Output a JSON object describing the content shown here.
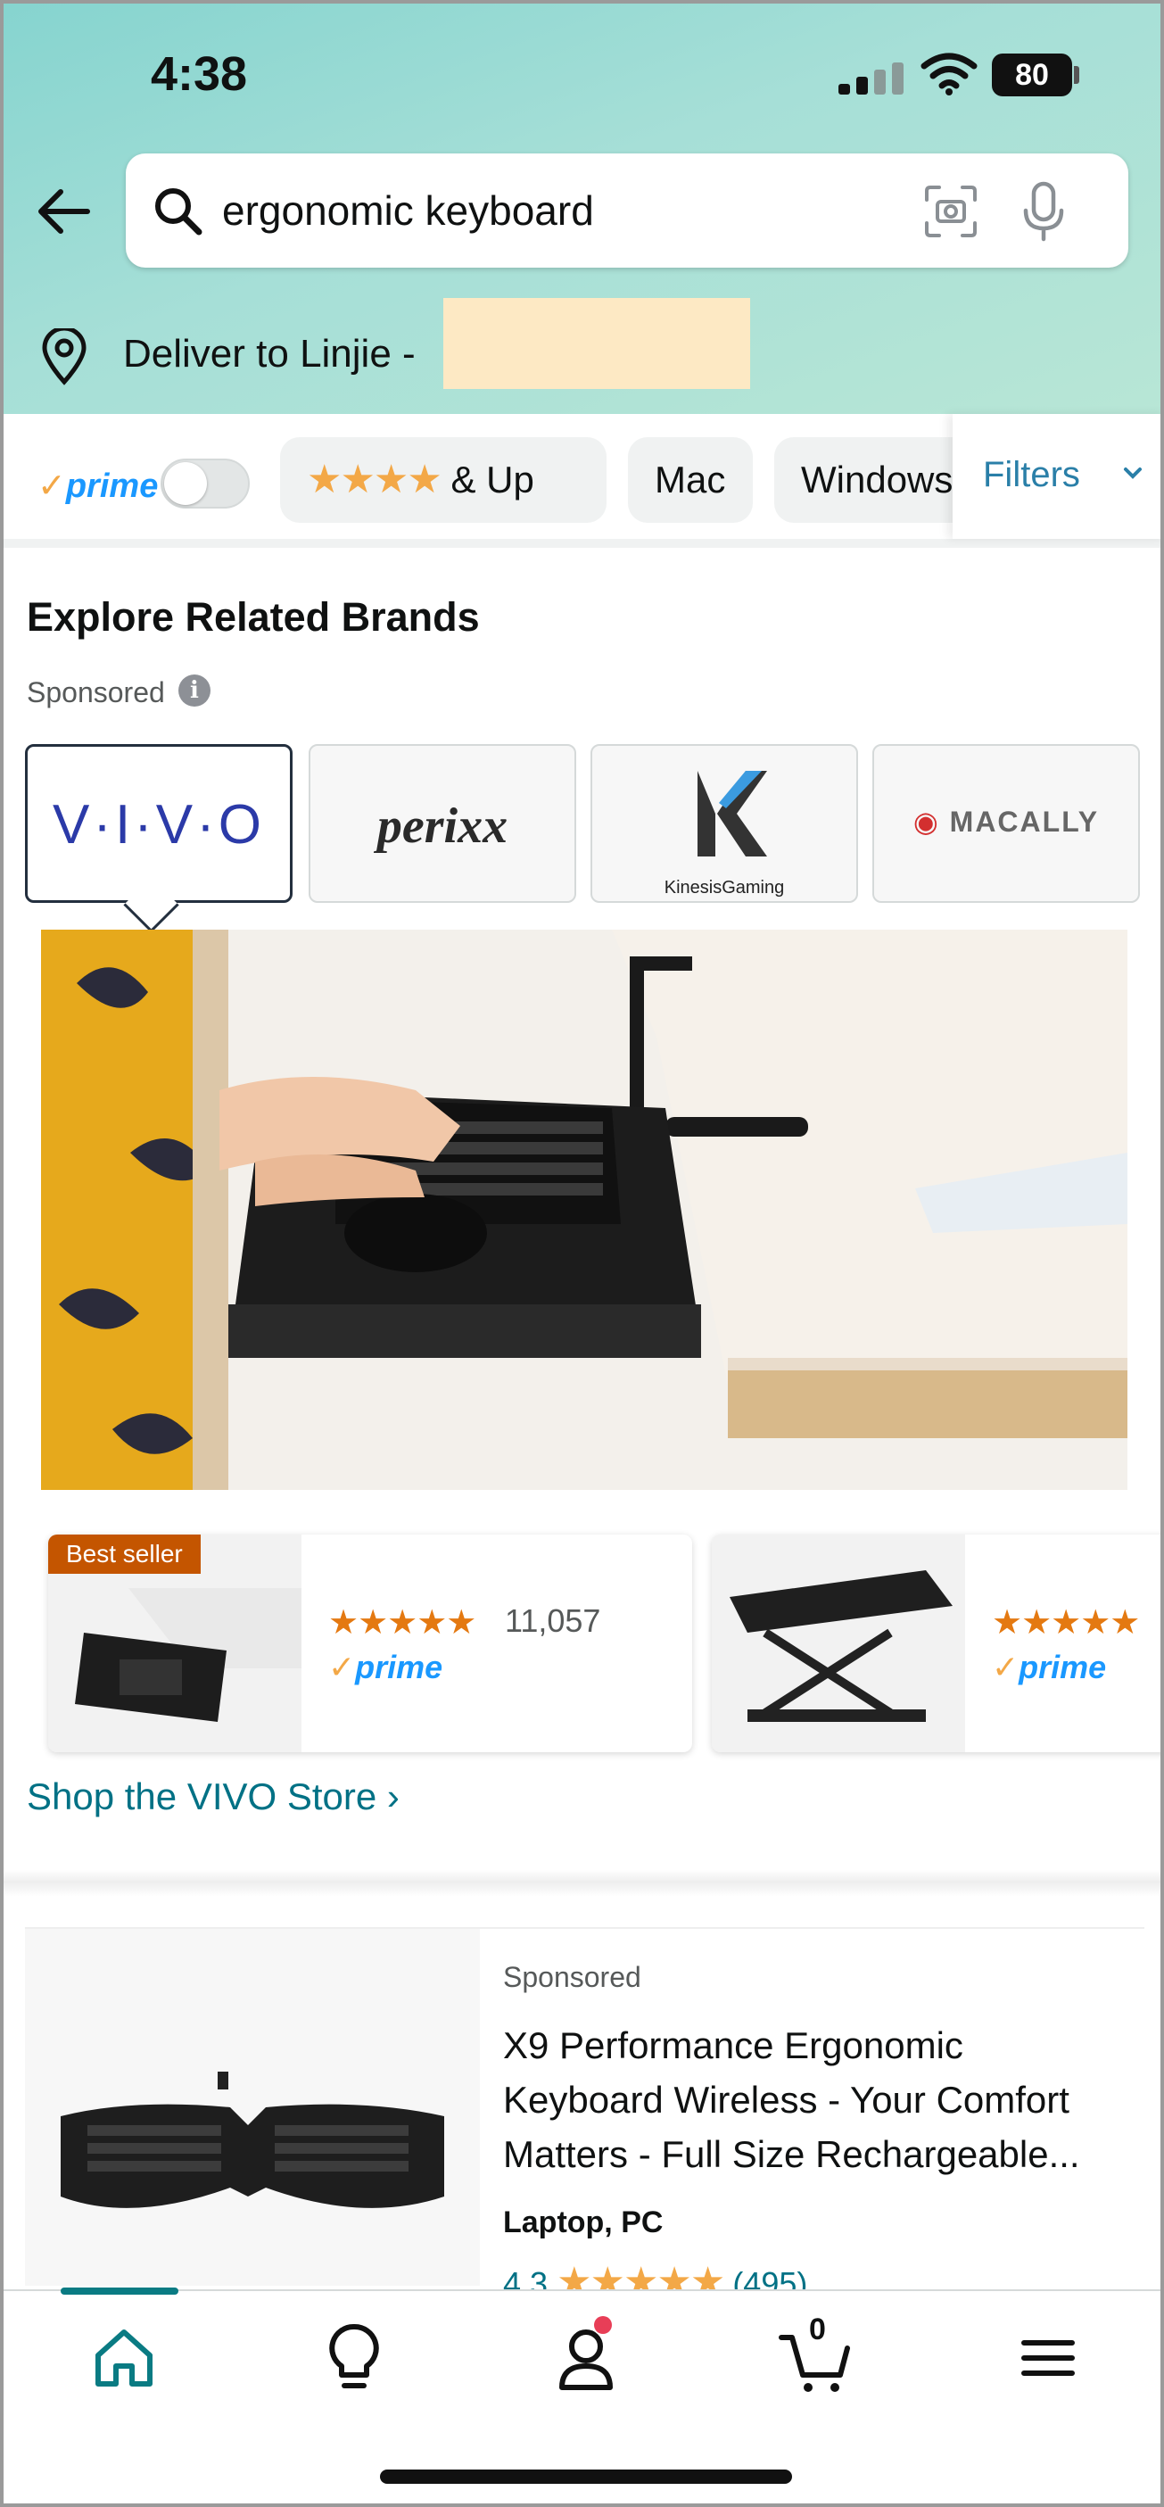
{
  "status_bar": {
    "time": "4:38",
    "battery": "80"
  },
  "search": {
    "value": "ergonomic keyboard"
  },
  "delivery": {
    "label": "Deliver to Linjie -"
  },
  "filters": {
    "prime_label": "prime",
    "rating_chip": "& Up",
    "chips": [
      "Mac",
      "Windows"
    ],
    "filters_label": "Filters"
  },
  "related_brands": {
    "title": "Explore Related Brands",
    "sponsored": "Sponsored",
    "brands": [
      {
        "name": "V·I·V·O",
        "selected": true
      },
      {
        "name": "perixx"
      },
      {
        "name": "KinesisGaming"
      },
      {
        "name": "MACALLY"
      }
    ]
  },
  "brand_products": [
    {
      "badge": "Best seller",
      "rating": 4.5,
      "review_count": "11,057",
      "prime": "prime"
    },
    {
      "rating": 4.5,
      "prime": "prime"
    }
  ],
  "shop_store_link": "Shop the VIVO Store ›",
  "sponsored_product": {
    "sponsored": "Sponsored",
    "title": "X9 Performance Ergonomic Keyboard Wireless - Your Comfort Matters - Full Size Rechargeable...",
    "subtitle": "Laptop, PC",
    "rating": "4.3",
    "review_count": "(495)"
  },
  "bottom_nav": {
    "items": [
      "home-icon",
      "lightbulb-icon",
      "account-icon",
      "cart-icon",
      "menu-icon"
    ],
    "cart_count": "0"
  },
  "colors": {
    "header_gradient_start": "#86d4cf",
    "header_gradient_end": "#b8e6d6",
    "link": "#007185",
    "star": "#f3a847",
    "prime_blue": "#1a98ff",
    "best_seller": "#c45500",
    "nav_accent": "#0a7b83"
  }
}
